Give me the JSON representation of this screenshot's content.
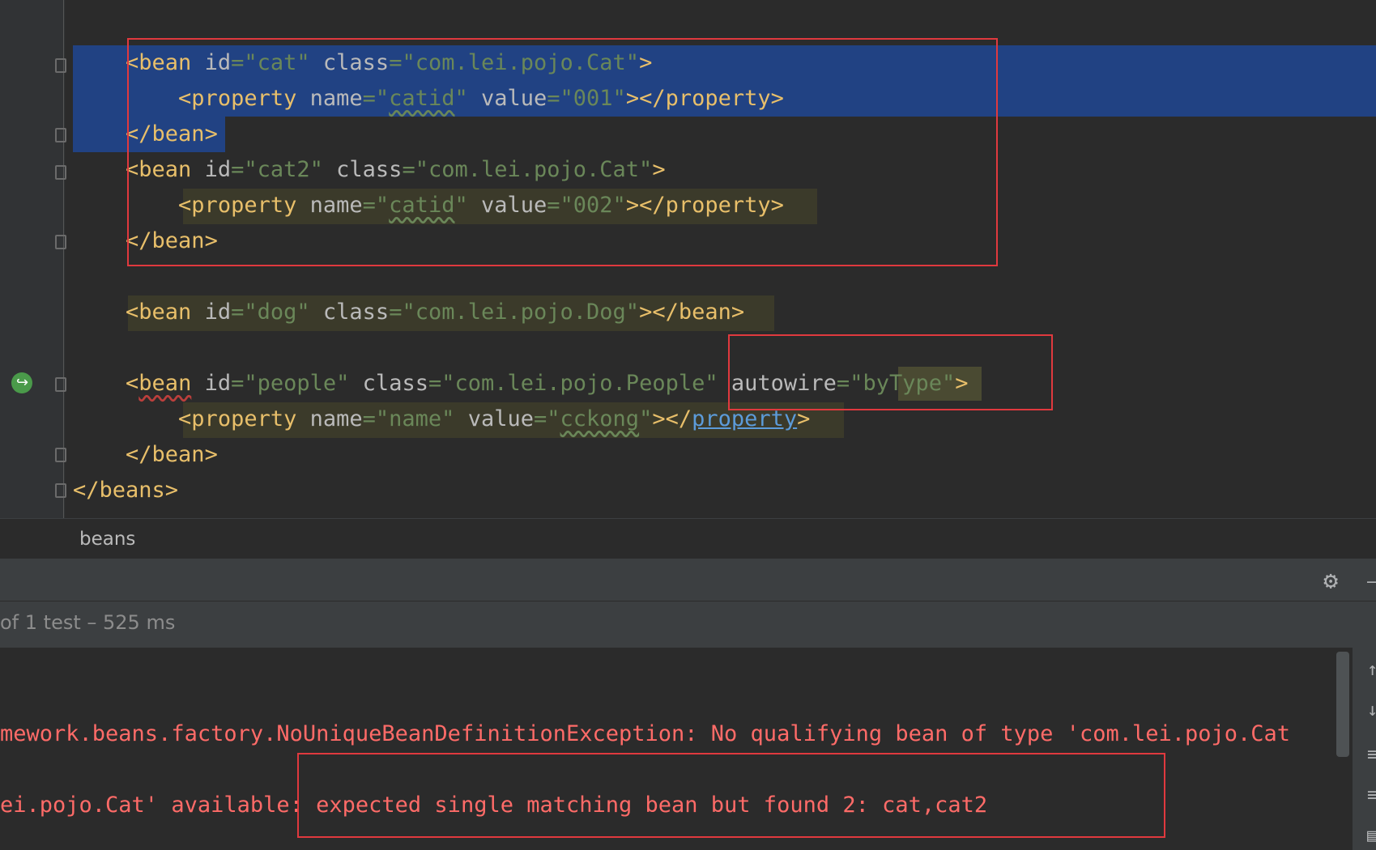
{
  "editor": {
    "lines": [
      {
        "indent": "    ",
        "tokens": [
          [
            "tag",
            "<bean "
          ],
          [
            "attr",
            "id"
          ],
          [
            "eq",
            "="
          ],
          [
            "val",
            "\"cat\""
          ],
          [
            "attr",
            " class"
          ],
          [
            "eq",
            "="
          ],
          [
            "val",
            "\"com.lei.pojo.Cat\""
          ],
          [
            "tag",
            ">"
          ]
        ]
      },
      {
        "indent": "        ",
        "tokens": [
          [
            "tag",
            "<property "
          ],
          [
            "attr",
            "name"
          ],
          [
            "eq",
            "="
          ],
          [
            "val",
            "\""
          ],
          [
            "valsq",
            "catid"
          ],
          [
            "val",
            "\""
          ],
          [
            "attr",
            " value"
          ],
          [
            "eq",
            "="
          ],
          [
            "val",
            "\"001\""
          ],
          [
            "tag",
            "></property>"
          ]
        ]
      },
      {
        "indent": "    ",
        "tokens": [
          [
            "tag",
            "</bean>"
          ]
        ]
      },
      {
        "indent": "    ",
        "tokens": [
          [
            "tag",
            "<bean "
          ],
          [
            "attr",
            "id"
          ],
          [
            "eq",
            "="
          ],
          [
            "val",
            "\"cat2\""
          ],
          [
            "attr",
            " class"
          ],
          [
            "eq",
            "="
          ],
          [
            "val",
            "\"com.lei.pojo.Cat\""
          ],
          [
            "tag",
            ">"
          ]
        ]
      },
      {
        "indent": "        ",
        "tokens": [
          [
            "tag",
            "<property "
          ],
          [
            "attr",
            "name"
          ],
          [
            "eq",
            "="
          ],
          [
            "val",
            "\""
          ],
          [
            "valsq",
            "catid"
          ],
          [
            "val",
            "\""
          ],
          [
            "attr",
            " value"
          ],
          [
            "eq",
            "="
          ],
          [
            "val",
            "\"002\""
          ],
          [
            "tag",
            "></property>"
          ]
        ]
      },
      {
        "indent": "    ",
        "tokens": [
          [
            "tag",
            "</bean>"
          ]
        ]
      },
      {
        "indent": "",
        "tokens": []
      },
      {
        "indent": "    ",
        "tokens": [
          [
            "tag",
            "<bean "
          ],
          [
            "attr",
            "id"
          ],
          [
            "eq",
            "="
          ],
          [
            "val",
            "\"dog\""
          ],
          [
            "attr",
            " class"
          ],
          [
            "eq",
            "="
          ],
          [
            "val",
            "\"com.lei.pojo.Dog\""
          ],
          [
            "tag",
            "></bean>"
          ]
        ]
      },
      {
        "indent": "",
        "tokens": []
      },
      {
        "indent": "    ",
        "tokens": [
          [
            "tag",
            "<"
          ],
          [
            "tagsq",
            "bean"
          ],
          [
            "attr",
            " id"
          ],
          [
            "eq",
            "="
          ],
          [
            "val",
            "\"people\""
          ],
          [
            "attr",
            " class"
          ],
          [
            "eq",
            "="
          ],
          [
            "val",
            "\"com.lei.pojo.People\""
          ],
          [
            "attr",
            " autowire"
          ],
          [
            "eq",
            "="
          ],
          [
            "val",
            "\""
          ],
          [
            "valhl",
            "byType"
          ],
          [
            "val",
            "\""
          ],
          [
            "tag",
            ">"
          ]
        ]
      },
      {
        "indent": "        ",
        "tokens": [
          [
            "tag",
            "<property "
          ],
          [
            "attr",
            "name"
          ],
          [
            "eq",
            "="
          ],
          [
            "val",
            "\"name\""
          ],
          [
            "attr",
            " value"
          ],
          [
            "eq",
            "="
          ],
          [
            "val",
            "\""
          ],
          [
            "valsq",
            "cckong"
          ],
          [
            "val",
            "\""
          ],
          [
            "tag",
            "></"
          ],
          [
            "link",
            "property"
          ],
          [
            "tag",
            ">"
          ]
        ]
      },
      {
        "indent": "    ",
        "tokens": [
          [
            "tag",
            "</bean>"
          ]
        ]
      },
      {
        "indent": "",
        "tokens": [
          [
            "tag",
            "</beans>"
          ]
        ]
      }
    ]
  },
  "breadcrumb": {
    "label": "beans"
  },
  "test_status": {
    "text": "of 1 test – 525 ms"
  },
  "console": {
    "line1": "mework.beans.factory.NoUniqueBeanDefinitionException: No qualifying bean of type 'com.lei.pojo.Cat",
    "line2": "ei.pojo.Cat' available: expected single matching bean but found 2: cat,cat2"
  },
  "icons": {
    "gear": "gear-icon",
    "run": "run-gutter-icon"
  },
  "colors": {
    "annotation_red": "#e0393e",
    "selection": "#214283",
    "tag": "#e8bf6a",
    "value": "#6a8759",
    "error": "#ff6b68"
  }
}
